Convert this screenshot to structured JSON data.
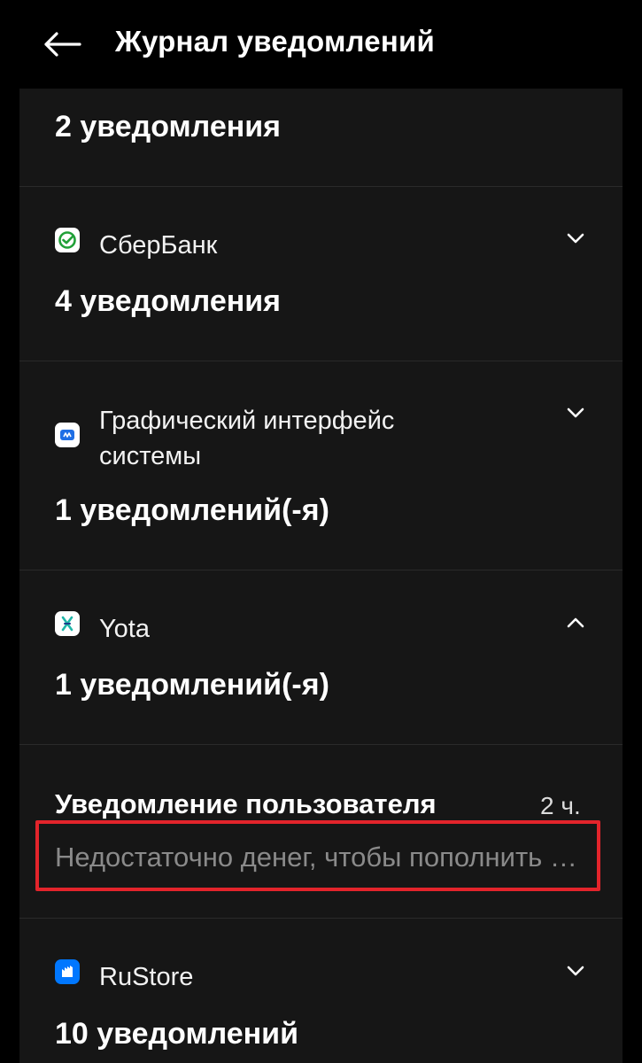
{
  "header": {
    "title": "Журнал уведомлений",
    "back_icon": "arrow-left-icon"
  },
  "groups": [
    {
      "app": "",
      "count": "2 уведомления"
    },
    {
      "app": "СберБанк",
      "icon": "sberbank-icon",
      "count": "4 уведомления",
      "expanded": false
    },
    {
      "app": "Графический интерфейс системы",
      "icon": "system-ui-icon",
      "count": "1 уведомлений(-я)",
      "expanded": false
    },
    {
      "app": "Yota",
      "icon": "yota-icon",
      "count": "1 уведомлений(-я)",
      "expanded": true
    },
    {
      "app": "RuStore",
      "icon": "rustore-icon",
      "count": "10 уведомлений",
      "expanded": false
    }
  ],
  "notification": {
    "title": "Уведомление пользователя",
    "time": "2 ч.",
    "body": "Недостаточно денег, чтобы пополнить счёт"
  },
  "colors": {
    "background": "#000000",
    "card": "#161616",
    "highlight": "#e3242b",
    "sber_green": "#21a038",
    "system_blue": "#1f6fe5",
    "yota_teal": "#1fb5a7",
    "rustore_blue": "#0077ff"
  }
}
